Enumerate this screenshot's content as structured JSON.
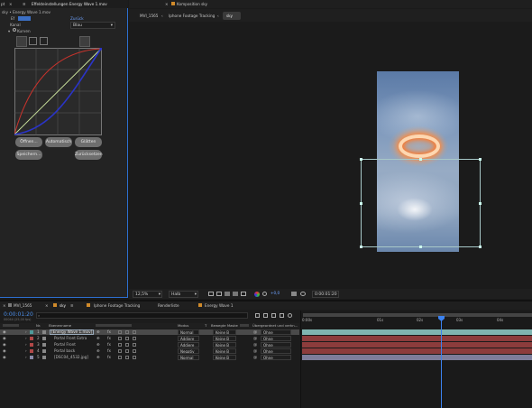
{
  "effects_panel": {
    "tab_prefix": "pt",
    "tab_title": "Effekteinstellungen Energy Wave 1.mov",
    "subtitle": "sky • Energy Wave 1.mov",
    "row_label": "Ef",
    "reset_label": "Zurück",
    "channel_label": "Kanal",
    "channel_value": "Blau",
    "curves_label": "Kurven",
    "buttons": [
      "Öffnen...",
      "Automatisch",
      "Glätten",
      "Speichern...",
      "Zurücksetzen"
    ]
  },
  "comp_panel": {
    "title": "Komposition sky",
    "tabs": [
      "MVI_1565",
      "Iphone Footage Tracking",
      "sky"
    ],
    "zoom": "12,5%",
    "resolution": "Halb",
    "exposure": "+0,0",
    "timecode": "0:00:01:20"
  },
  "timeline": {
    "tabs": [
      "MVI_1565",
      "sky",
      "Iphone Footage Tracking",
      "Renderliste",
      "Energy Wave 1"
    ],
    "timecode": "0:00:01:20",
    "fps_info": "00044 (25,00 fps)",
    "search_placeholder": "",
    "columns": {
      "nr": "Nr.",
      "name": "Ebenenname",
      "mode": "Modus",
      "t": "T",
      "trackmatte": "Bewegte Maske",
      "parent": "Übergeordnet und verkn..."
    },
    "layers": [
      {
        "nr": "1",
        "name": "[Energy Wave 1.mov]",
        "mode": "Normal",
        "matte": "Keine B",
        "parent": "Ohne",
        "color": "#4e9a9a",
        "selected": true
      },
      {
        "nr": "2",
        "name": "Portal Front Extra",
        "mode": "Addiere",
        "matte": "Keine B",
        "parent": "Ohne",
        "color": "#b04848",
        "selected": false
      },
      {
        "nr": "3",
        "name": "Portal Front",
        "mode": "Addiere",
        "matte": "Keine B",
        "parent": "Ohne",
        "color": "#b04848",
        "selected": false
      },
      {
        "nr": "4",
        "name": "Portal back",
        "mode": "Negativ",
        "matte": "Keine B",
        "parent": "Ohne",
        "color": "#b04848",
        "selected": false
      },
      {
        "nr": "5",
        "name": "[DSC04_4532.jpg]",
        "mode": "Normal",
        "matte": "Keine B",
        "parent": "Ohne",
        "color": "#8a8aa8",
        "selected": false
      }
    ],
    "ruler_labels": [
      "0:00s",
      "01s",
      "02s",
      "03s",
      "04s"
    ]
  }
}
